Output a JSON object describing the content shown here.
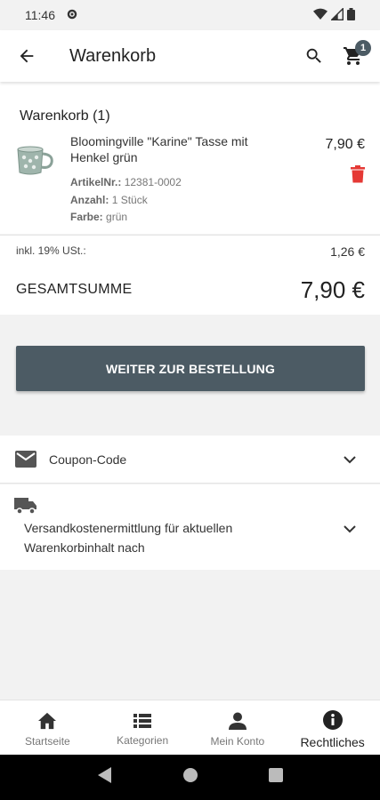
{
  "status_bar": {
    "time": "11:46"
  },
  "app_bar": {
    "title": "Warenkorb",
    "cart_count": "1"
  },
  "cart": {
    "heading": "Warenkorb (1)",
    "item": {
      "name": "Bloomingville \"Karine\" Tasse mit Henkel grün",
      "price": "7,90 €",
      "article_label": "ArtikelNr.:",
      "article_value": "12381-0002",
      "quantity_label": "Anzahl:",
      "quantity_value": "1 Stück",
      "color_label": "Farbe:",
      "color_value": "grün"
    }
  },
  "totals": {
    "vat_label": "inkl. 19% USt.:",
    "vat_value": "1,26 €",
    "total_label": "GESAMTSUMME",
    "total_value": "7,90 €"
  },
  "checkout_button": "WEITER ZUR BESTELLUNG",
  "panels": {
    "coupon_label": "Coupon-Code",
    "shipping_label_line1": "Versandkostenermittlung für aktuellen",
    "shipping_label_line2": "Warenkorbinhalt nach"
  },
  "bottom_nav": [
    {
      "label": "Startseite",
      "icon": "home-icon"
    },
    {
      "label": "Kategorien",
      "icon": "list-icon"
    },
    {
      "label": "Mein Konto",
      "icon": "person-icon"
    },
    {
      "label": "Rechtliches",
      "icon": "info-icon",
      "active": true
    }
  ],
  "colors": {
    "accent": "#4c5b64",
    "delete": "#e53935"
  }
}
